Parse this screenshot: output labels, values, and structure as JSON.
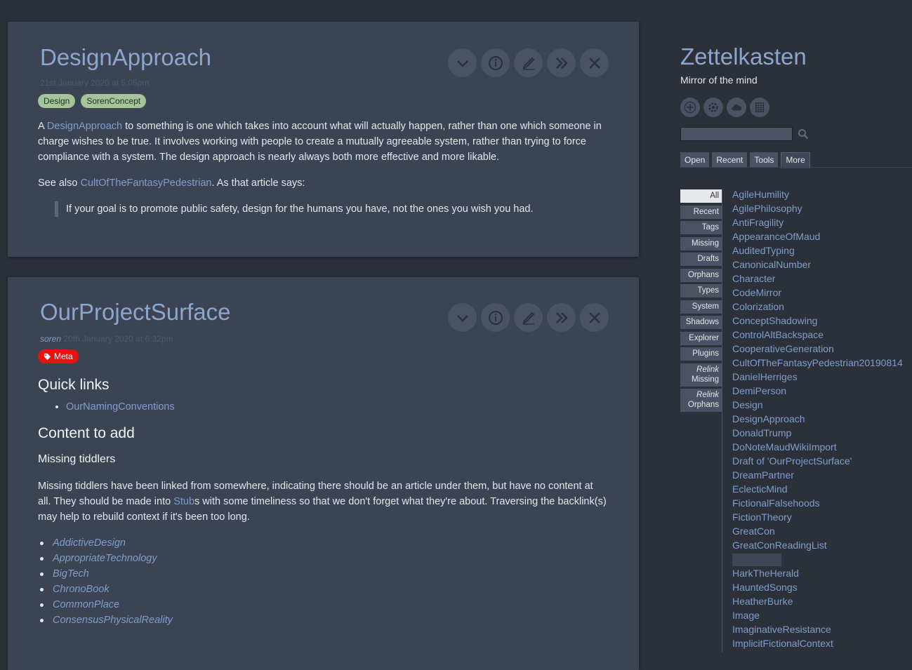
{
  "tiddlers": [
    {
      "title": "DesignApproach",
      "date": "21st January 2020 at 5:05pm",
      "tags": [
        "Design",
        "SorenConcept"
      ],
      "p1_pre": "A ",
      "p1_link": "DesignApproach",
      "p1_post": " to something is one which takes into account what will actually happen, rather than one which someone in charge wishes to be true. It involves working with people to create a mutually agreeable system, rather than trying to force compliance with a system. The design approach is nearly always both more effective and more likable.",
      "p2_pre": "See also ",
      "p2_link": "CultOfTheFantasyPedestrian",
      "p2_post": ". As that article says:",
      "quote": "If your goal is to promote public safety, design for the humans you have, not the ones you wish you had."
    },
    {
      "title": "OurProjectSurface",
      "modifier": "soren",
      "date": "20th January 2020 at 6:32pm",
      "tag": "Meta",
      "h_quick": "Quick links",
      "quick_links": [
        "OurNamingConventions"
      ],
      "h_content": "Content to add",
      "h_missing": "Missing tiddlers",
      "p_pre": "Missing tiddlers have been linked from somewhere, indicating there should be an article under them, but have no content at all. They should be made into ",
      "p_link": "Stub",
      "p_post": "s with some timeliness so that we don't forget what they're about. Traversing the backlink(s) may help to rebuild context if it's been too long.",
      "missing": [
        "AddictiveDesign",
        "AppropriateTechnology",
        "BigTech",
        "ChronoBook",
        "CommonPlace",
        "ConsensusPhysicalReality"
      ]
    }
  ],
  "sidebar": {
    "title": "Zettelkasten",
    "subtitle": "Mirror of the mind",
    "search_value": "",
    "tabs": [
      "Open",
      "Recent",
      "Tools",
      "More"
    ],
    "active_tab": "More",
    "subtabs": [
      "All",
      "Recent",
      "Tags",
      "Missing",
      "Drafts",
      "Orphans",
      "Types",
      "System",
      "Shadows",
      "Explorer",
      "Plugins"
    ],
    "relink_missing": [
      "Relink",
      "Missing"
    ],
    "relink_orphans": [
      "Relink",
      "Orphans"
    ],
    "all_items": [
      "AgileHumility",
      "AgilePhilosophy",
      "AntiFragility",
      "AppearanceOfMaud",
      "AuditedTyping",
      "CanonicalNumber",
      "Character",
      "CodeMirror",
      "Colorization",
      "ConceptShadowing",
      "ControlAltBackspace",
      "CooperativeGeneration",
      "CultOfTheFantasyPedestrian20190814",
      "DanielHerriges",
      "DemiPerson",
      "Design",
      "DesignApproach",
      "DonaldTrump",
      "DoNoteMaudWikiImport",
      "Draft of 'OurProjectSurface'",
      "DreamPartner",
      "EclecticMind",
      "FictionalFalsehoods",
      "FictionTheory",
      "GreatCon",
      "GreatConReadingList",
      "",
      "HarkTheHerald",
      "HauntedSongs",
      "HeatherBurke",
      "Image",
      "ImaginativeResistance",
      "ImplicitFictionalContext"
    ]
  },
  "colors": {
    "background": "#2c3038",
    "tiddler_bg": "#3c4352",
    "link": "#7f9ecf",
    "title": "#8ba6cf",
    "tag_green": "#a4c49a",
    "tag_red": "#e8120f"
  },
  "icons": {
    "tiddler_controls": [
      "chevron-down-icon",
      "info-icon",
      "edit-icon",
      "double-chevron-right-icon",
      "close-icon"
    ],
    "page_controls": [
      "plus-icon",
      "gear-icon",
      "cloud-icon",
      "grid-icon"
    ],
    "search": "search-icon",
    "tag_meta": "tag-icon"
  }
}
